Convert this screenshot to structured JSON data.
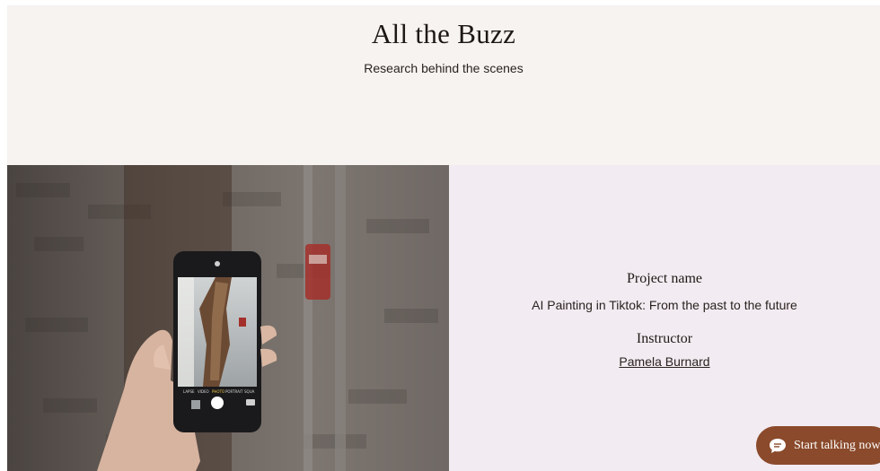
{
  "hero": {
    "title": "All the Buzz",
    "subtitle": "Research behind the scenes"
  },
  "project": {
    "name_heading": "Project name",
    "name_value": "AI Painting in Tiktok: From the past to the future",
    "instructor_heading": "Instructor",
    "instructor_name": "Pamela Burnard"
  },
  "phone_camera": {
    "modes": [
      "LAPSE",
      "VIDEO",
      "PHOTO",
      "PORTRAIT",
      "SQUA"
    ]
  },
  "chat": {
    "label": "Start talking now",
    "icon": "chat-bubble-icon"
  },
  "colors": {
    "page_bg": "#f6f3f0",
    "info_bg": "#f2ebf1",
    "chat_bg": "#8a4a2b"
  }
}
